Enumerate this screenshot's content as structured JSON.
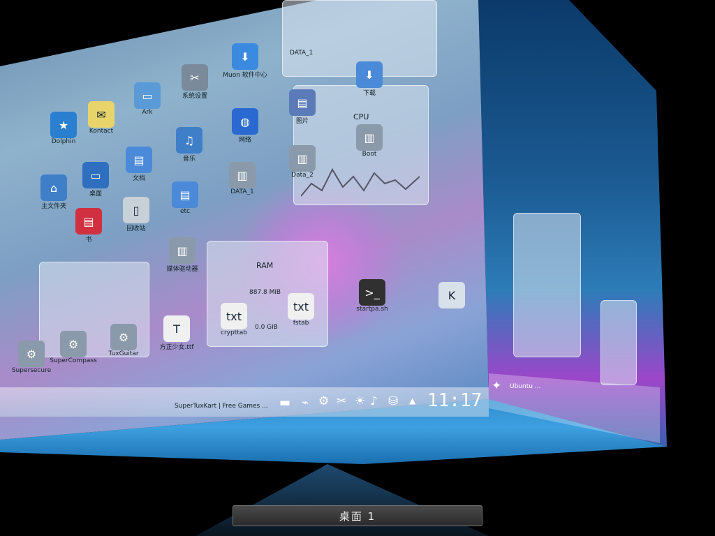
{
  "desktop": {
    "icons": [
      {
        "id": "konqueror",
        "label": "Dolphin",
        "glyph": "★"
      },
      {
        "id": "notes",
        "label": "Kontact",
        "glyph": "✉"
      },
      {
        "id": "archive",
        "label": "Ark",
        "glyph": "▭"
      },
      {
        "id": "tools",
        "label": "系统设置",
        "glyph": "✂"
      },
      {
        "id": "muon",
        "label": "Muon 软件中心",
        "glyph": "⬇"
      },
      {
        "id": "folder-home",
        "label": "主文件夹",
        "glyph": "⌂"
      },
      {
        "id": "folder-doc",
        "label": "文档",
        "glyph": "▤"
      },
      {
        "id": "folder-music",
        "label": "音乐",
        "glyph": "♫"
      },
      {
        "id": "globe",
        "label": "网络",
        "glyph": "◍"
      },
      {
        "id": "desktop-icon",
        "label": "桌面",
        "glyph": "▭"
      },
      {
        "id": "trash",
        "label": "回收站",
        "glyph": "▯"
      },
      {
        "id": "folder-etc",
        "label": "etc",
        "glyph": "▤"
      },
      {
        "id": "red-folder",
        "label": "书",
        "glyph": "▤"
      },
      {
        "id": "disk-data1",
        "label": "DATA_1",
        "glyph": "▥"
      },
      {
        "id": "disk-data2",
        "label": "Data_2",
        "glyph": "▥"
      },
      {
        "id": "disk-boot",
        "label": "Boot",
        "glyph": "▥"
      },
      {
        "id": "disk-media",
        "label": "媒体驱动器",
        "glyph": "▥"
      },
      {
        "id": "folder-pics",
        "label": "图片",
        "glyph": "▤"
      },
      {
        "id": "folder-down",
        "label": "下载",
        "glyph": "⬇"
      },
      {
        "id": "txt-crypttab",
        "label": "crypttab",
        "glyph": "txt"
      },
      {
        "id": "txt-fstab",
        "label": "fstab",
        "glyph": "txt"
      },
      {
        "id": "startpa",
        "label": "startpa.sh",
        "glyph": ">_"
      },
      {
        "id": "font-file",
        "label": "方正少女.ttf",
        "glyph": "T"
      },
      {
        "id": "k-icon",
        "label": "",
        "glyph": "K"
      },
      {
        "id": "gear1",
        "label": "Supersecure",
        "glyph": "⚙"
      },
      {
        "id": "gear2",
        "label": "SuperCompass",
        "glyph": "⚙"
      },
      {
        "id": "gear3",
        "label": "TuxGuitar",
        "glyph": "⚙"
      }
    ],
    "widgets": {
      "cpu_title": "CPU",
      "cpu_disk_a": "Data_2",
      "cpu_disk_b": "Boot",
      "ram_title": "RAM",
      "ram_value": "887.8 MiB",
      "ram_value2": "0.0 GiB",
      "kvm_title": "DATA_1"
    },
    "taskbar": {
      "task_left": "SuperTuxKart | Free Games ...",
      "clock": "11:17"
    },
    "side_taskbar": "Ubuntu ...",
    "pager_label": "桌面 1"
  },
  "colors": {
    "accent": "#3ea0e0",
    "panel": "#dce6f0"
  }
}
